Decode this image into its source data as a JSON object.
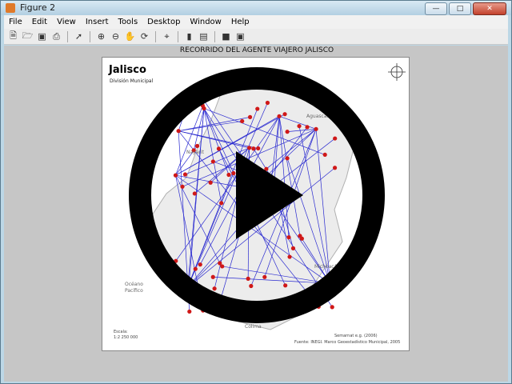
{
  "window": {
    "title": "Figure 2"
  },
  "menu": [
    "File",
    "Edit",
    "View",
    "Insert",
    "Tools",
    "Desktop",
    "Window",
    "Help"
  ],
  "toolbar_icons": [
    "new-figure-icon",
    "open-icon",
    "save-icon",
    "print-icon",
    "arrow-icon",
    "zoom-in-icon",
    "zoom-out-icon",
    "pan-icon",
    "rotate-icon",
    "data-cursor-icon",
    "colorbar-icon",
    "legend-icon",
    "hide-plot-tools-icon",
    "show-plot-tools-icon"
  ],
  "plot": {
    "title": "RECORRIDO DEL AGENTE VIAJERO JALISCO"
  },
  "map": {
    "title": "Jalisco",
    "subtitle": "División Municipal",
    "labels": {
      "nayarit": "Nayarit",
      "aguascalientes": "Aguascalientes",
      "michoacan": "Michoacán",
      "oceano_1": "Océano",
      "oceano_2": "Pacífico",
      "colima": "Colima"
    },
    "scale_label": "Escala:",
    "scale_value": "1:2 250 000",
    "source_1": "Semarnat e.g. (2006)",
    "source_2": "Fuente: INEGI. Marco Geoestadístico Municipal, 2005"
  },
  "overlay": {
    "icon": "play-icon"
  },
  "colors": {
    "route": "#2a2ad0",
    "node": "#d01818",
    "overlay": "#000000"
  }
}
